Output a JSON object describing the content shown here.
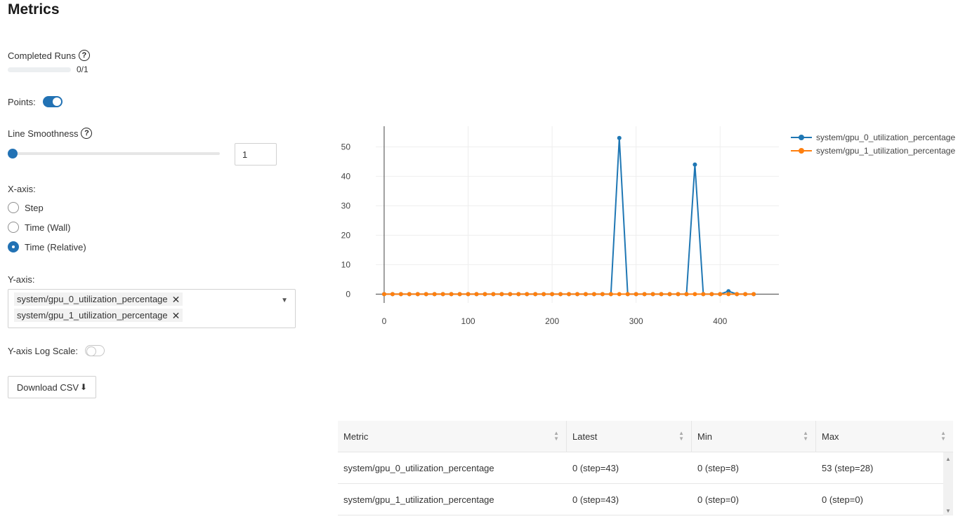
{
  "header": {
    "title": "Metrics"
  },
  "completed_runs": {
    "label": "Completed Runs",
    "progress": 0.0,
    "text": "0/1"
  },
  "points": {
    "label": "Points:",
    "enabled": true
  },
  "smoothness": {
    "label": "Line Smoothness",
    "value": "1",
    "slider_fraction": 0.0
  },
  "xaxis": {
    "label": "X-axis:",
    "options": [
      {
        "label": "Step",
        "checked": false
      },
      {
        "label": "Time (Wall)",
        "checked": false
      },
      {
        "label": "Time (Relative)",
        "checked": true
      }
    ]
  },
  "yaxis": {
    "label": "Y-axis:",
    "selected": [
      "system/gpu_0_utilization_percentage",
      "system/gpu_1_utilization_percentage"
    ]
  },
  "log_scale": {
    "label": "Y-axis Log Scale:",
    "enabled": false
  },
  "download": {
    "label": "Download CSV"
  },
  "icons": {
    "help": "question-circle-icon",
    "download": "download-icon",
    "close": "close-icon",
    "chevron": "chevron-down-icon"
  },
  "colors": {
    "accent": "#2272b4",
    "series0": "#1f77b4",
    "series1": "#ff7f0e"
  },
  "chart_data": {
    "type": "line",
    "xlim": [
      -10,
      470
    ],
    "ylim": [
      -3,
      57
    ],
    "xticks": [
      0,
      100,
      200,
      300,
      400
    ],
    "yticks": [
      0,
      10,
      20,
      30,
      40,
      50
    ],
    "grid": true,
    "legend_position": "right",
    "series": [
      {
        "name": "system/gpu_0_utilization_percentage",
        "color": "#1f77b4",
        "x": [
          0,
          10,
          20,
          30,
          40,
          50,
          60,
          70,
          80,
          90,
          100,
          110,
          120,
          130,
          140,
          150,
          160,
          170,
          180,
          190,
          200,
          210,
          220,
          230,
          240,
          250,
          260,
          270,
          280,
          290,
          300,
          310,
          320,
          330,
          340,
          350,
          360,
          370,
          380,
          390,
          400,
          410,
          420,
          430,
          440
        ],
        "y": [
          0,
          0,
          0,
          0,
          0,
          0,
          0,
          0,
          0,
          0,
          0,
          0,
          0,
          0,
          0,
          0,
          0,
          0,
          0,
          0,
          0,
          0,
          0,
          0,
          0,
          0,
          0,
          0,
          53,
          0,
          0,
          0,
          0,
          0,
          0,
          0,
          0,
          44,
          0,
          0,
          0,
          1,
          0,
          0,
          0
        ]
      },
      {
        "name": "system/gpu_1_utilization_percentage",
        "color": "#ff7f0e",
        "x": [
          0,
          10,
          20,
          30,
          40,
          50,
          60,
          70,
          80,
          90,
          100,
          110,
          120,
          130,
          140,
          150,
          160,
          170,
          180,
          190,
          200,
          210,
          220,
          230,
          240,
          250,
          260,
          270,
          280,
          290,
          300,
          310,
          320,
          330,
          340,
          350,
          360,
          370,
          380,
          390,
          400,
          410,
          420,
          430,
          440
        ],
        "y": [
          0,
          0,
          0,
          0,
          0,
          0,
          0,
          0,
          0,
          0,
          0,
          0,
          0,
          0,
          0,
          0,
          0,
          0,
          0,
          0,
          0,
          0,
          0,
          0,
          0,
          0,
          0,
          0,
          0,
          0,
          0,
          0,
          0,
          0,
          0,
          0,
          0,
          0,
          0,
          0,
          0,
          0,
          0,
          0,
          0
        ]
      }
    ]
  },
  "table": {
    "columns": [
      "Metric",
      "Latest",
      "Min",
      "Max"
    ],
    "rows": [
      [
        "system/gpu_0_utilization_percentage",
        "0 (step=43)",
        "0 (step=8)",
        "53 (step=28)"
      ],
      [
        "system/gpu_1_utilization_percentage",
        "0 (step=43)",
        "0 (step=0)",
        "0 (step=0)"
      ]
    ]
  }
}
